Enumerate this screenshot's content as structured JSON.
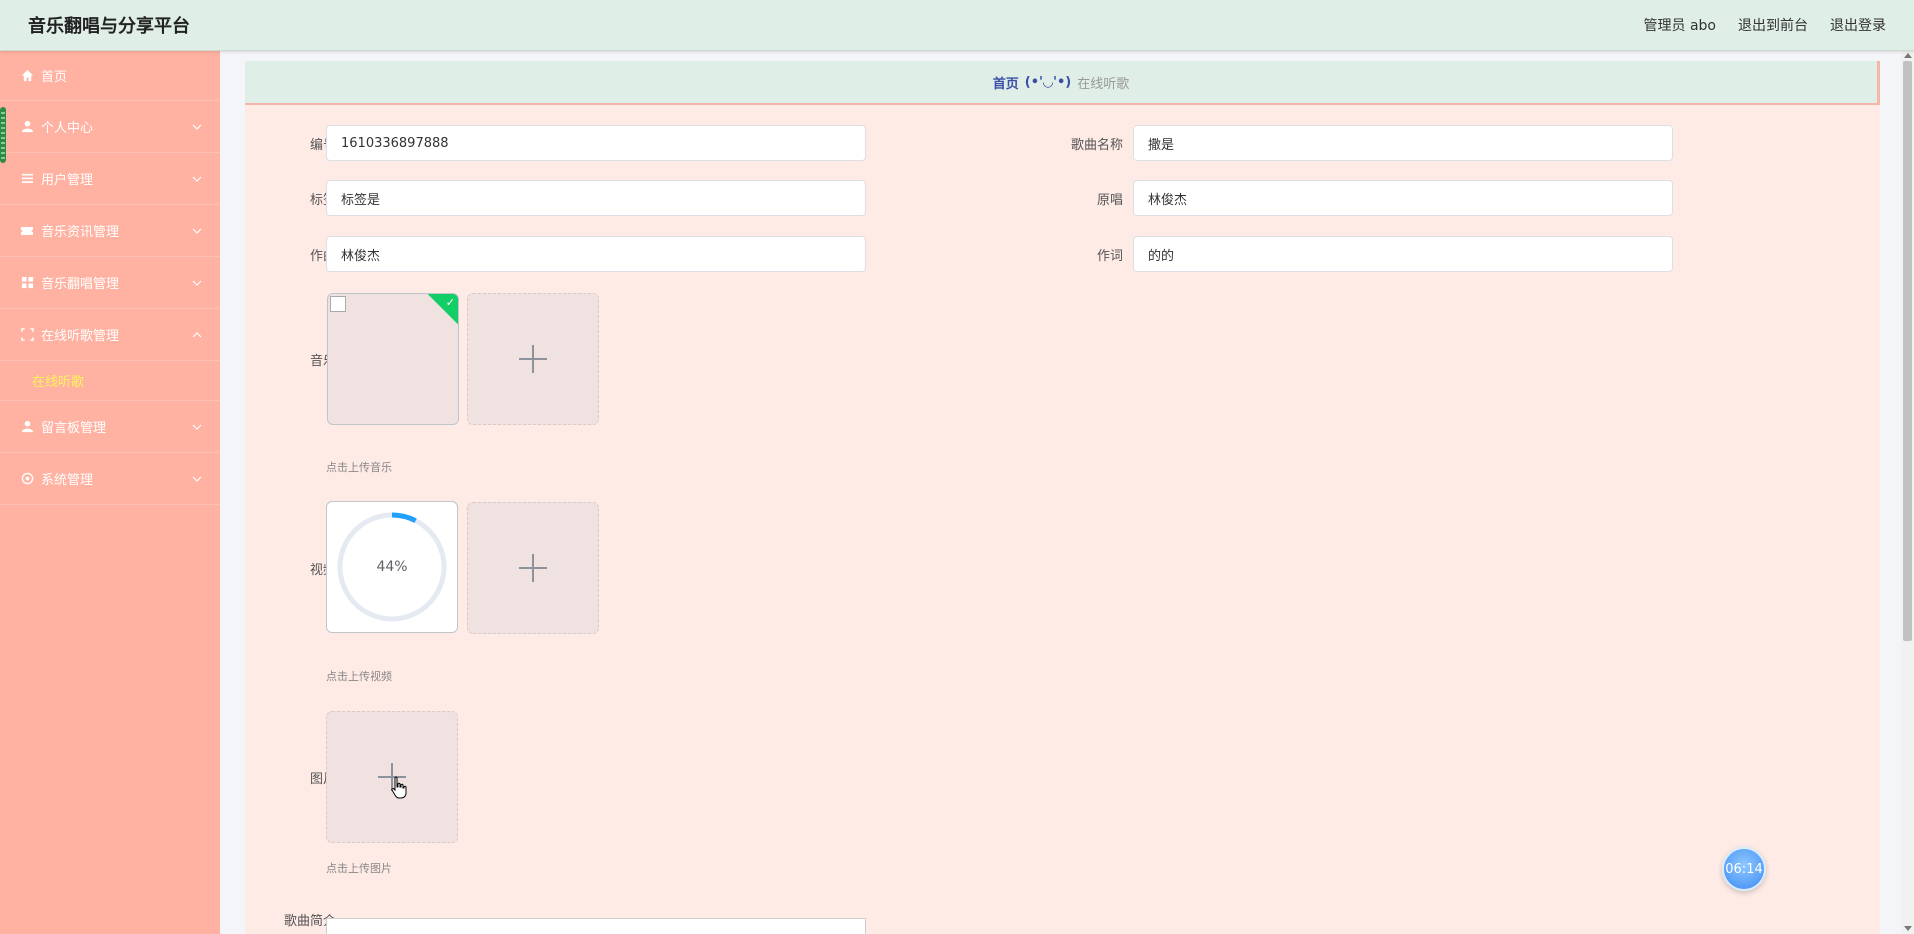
{
  "header": {
    "brand": "音乐翻唱与分享平台",
    "admin_label": "管理员 abo",
    "to_front": "退出到前台",
    "logout": "退出登录"
  },
  "sidebar": {
    "items": [
      {
        "label": "首页",
        "icon": "home-icon"
      },
      {
        "label": "个人中心",
        "icon": "user-icon"
      },
      {
        "label": "用户管理",
        "icon": "list-icon"
      },
      {
        "label": "音乐资讯管理",
        "icon": "ticket-icon"
      },
      {
        "label": "音乐翻唱管理",
        "icon": "grid-icon"
      },
      {
        "label": "在线听歌管理",
        "icon": "fullscreen-icon"
      },
      {
        "label": "在线听歌",
        "icon": ""
      },
      {
        "label": "留言板管理",
        "icon": "user-icon"
      },
      {
        "label": "系统管理",
        "icon": "settings-icon"
      }
    ]
  },
  "breadcrumb": {
    "home": "首页",
    "sep": "(•'◡'•)",
    "current": "在线听歌"
  },
  "form": {
    "number_label": "编号",
    "number_value": "1610336897888",
    "song_label": "歌曲名称",
    "song_value": "撒是",
    "tag_label": "标签",
    "tag_value": "标签是",
    "singer_label": "原唱",
    "singer_value": "林俊杰",
    "composer_label": "作曲",
    "composer_value": "林俊杰",
    "lyricist_label": "作词",
    "lyricist_value": "的的",
    "music_label": "音乐",
    "music_hint": "点击上传音乐",
    "video_label": "视频",
    "video_progress": "44%",
    "video_progress_value": 44,
    "video_hint": "点击上传视频",
    "image_label": "图片",
    "image_hint": "点击上传图片",
    "intro_label": "歌曲简介"
  },
  "timer": "06:14",
  "colors": {
    "sidebar_bg": "#ffb2a2",
    "active_sub": "#fff35a",
    "header_bg": "#dfeee6",
    "content_bg": "#ffebe6",
    "progress": "#20a0ff",
    "success": "#13ce66"
  }
}
